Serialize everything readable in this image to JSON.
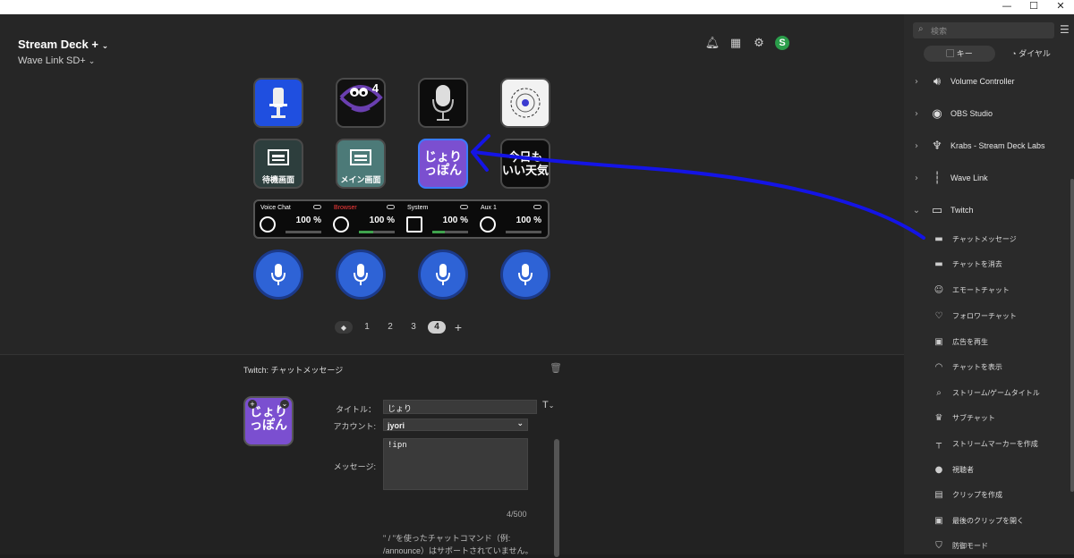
{
  "window": {
    "minimize": "—",
    "maximize": "☐",
    "close": "✕"
  },
  "device": {
    "title": "Stream Deck +",
    "subtitle": "Wave Link SD+"
  },
  "keys": [
    {
      "label": "",
      "bg": "#1f4fe0"
    },
    {
      "label": "4",
      "bg": "#111111"
    },
    {
      "label": "",
      "bg": "#0d0d0d"
    },
    {
      "label": "",
      "bg": "#f2f2f2"
    },
    {
      "label": "待機画面",
      "bg": "#2d3e3d"
    },
    {
      "label": "メイン画面",
      "bg": "#4c7a78"
    },
    {
      "label": "じょり\nっぽん",
      "bg": "#7b4fd0"
    },
    {
      "label": "今日も\nいい天気",
      "bg": "#0d0d0d"
    }
  ],
  "lcd": [
    {
      "name": "Voice Chat",
      "pct": "100 %",
      "fill": 0.0
    },
    {
      "name": "Browser",
      "pct": "100 %",
      "fill": 0.4
    },
    {
      "name": "System",
      "pct": "100 %",
      "fill": 0.35
    },
    {
      "name": "Aux 1",
      "pct": "100 %",
      "fill": 0.0
    }
  ],
  "pager": {
    "pages": [
      "1",
      "2",
      "3",
      "4"
    ],
    "active": "4",
    "pin": "◆",
    "add": "+"
  },
  "inspector": {
    "title": "Twitch:   チャットメッセージ",
    "title_label": "タイトル：",
    "title_value": "じょり",
    "account_label": "アカウント:",
    "account_value": "jyori",
    "message_label": "メッセージ:",
    "message_value": "!ipn",
    "counter": "4/500",
    "note": "\" / \"を使ったチャットコマンド（例: /announce）はサポートされていません。",
    "font_btn": "T"
  },
  "sidebar": {
    "search_placeholder": "検索",
    "tab_key": "キー",
    "tab_dial": "ダイヤル",
    "categories": [
      {
        "label": "Volume Controller",
        "icon": "volume-icon",
        "expanded": false
      },
      {
        "label": "OBS Studio",
        "icon": "obs-icon",
        "expanded": false
      },
      {
        "label": "Krabs - Stream Deck Labs",
        "icon": "crab-icon",
        "expanded": false
      },
      {
        "label": "Wave Link",
        "icon": "waveform-icon",
        "expanded": false
      },
      {
        "label": "Twitch",
        "icon": "twitch-icon",
        "expanded": true
      }
    ],
    "actions": [
      "チャットメッセージ",
      "チャットを消去",
      "エモートチャット",
      "フォロワーチャット",
      "広告を再生",
      "チャットを表示",
      "ストリーム/ゲームタイトル",
      "サブチャット",
      "ストリームマーカーを作成",
      "視聴者",
      "クリップを作成",
      "最後のクリップを開く",
      "防御モード"
    ]
  },
  "colors": {
    "accent": "#1414e6",
    "dial": "#2e63d6",
    "purple_key": "#7b4fd0"
  }
}
